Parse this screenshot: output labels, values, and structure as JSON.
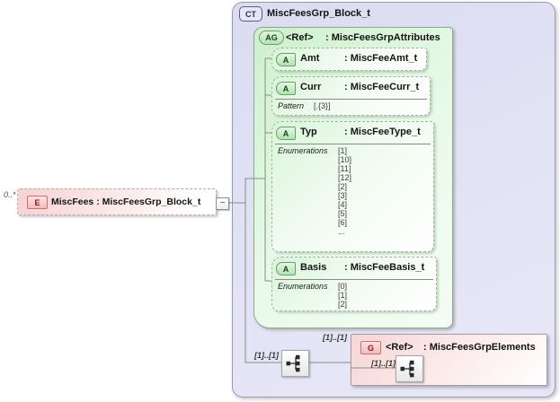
{
  "diagram": {
    "complex_type": {
      "badge": "CT",
      "title": "MiscFeesGrp_Block_t"
    },
    "element": {
      "badge": "E",
      "multiplicity": "0..*",
      "label": "MiscFees : MiscFeesGrp_Block_t",
      "collapse_glyph": "−"
    },
    "attribute_group": {
      "badge": "AG",
      "ref_label": "<Ref>",
      "type_label": ": MiscFeesGrpAttributes"
    },
    "attribute_badge": "A",
    "attributes": [
      {
        "name": "Amt",
        "type": ": MiscFeeAmt_t"
      },
      {
        "name": "Curr",
        "type": ": MiscFeeCurr_t",
        "facet_label": "Pattern",
        "values": [
          "[.{3}]"
        ]
      },
      {
        "name": "Typ",
        "type": ": MiscFeeType_t",
        "facet_label": "Enumerations",
        "values": [
          "[1]",
          "[10]",
          "[11]",
          "[12]",
          "[2]",
          "[3]",
          "[4]",
          "[5]",
          "[6]",
          "..."
        ]
      },
      {
        "name": "Basis",
        "type": ": MiscFeeBasis_t",
        "facet_label": "Enumerations",
        "values": [
          "[0]",
          "[1]",
          "[2]"
        ]
      }
    ],
    "content_model": {
      "outer_sequence_multiplicity": "[1]..[1]",
      "group_ref_multiplicity": "[1]..[1]",
      "group": {
        "badge": "G",
        "ref_label": "<Ref>",
        "type_label": ": MiscFeesGrpElements",
        "inner_sequence_multiplicity": "[1]..[1]"
      }
    }
  },
  "colors": {
    "complex_type_fill": "#dcdcf2",
    "attribute_group_fill": "#cdf0cd",
    "attribute_fill": "#d9f5d9",
    "element_fill": "#f7d3d3",
    "group_fill": "#f7d6d6",
    "badge_green": "#b2e4b2",
    "badge_red_border": "#c87070",
    "connector": "#8a8a8a"
  }
}
